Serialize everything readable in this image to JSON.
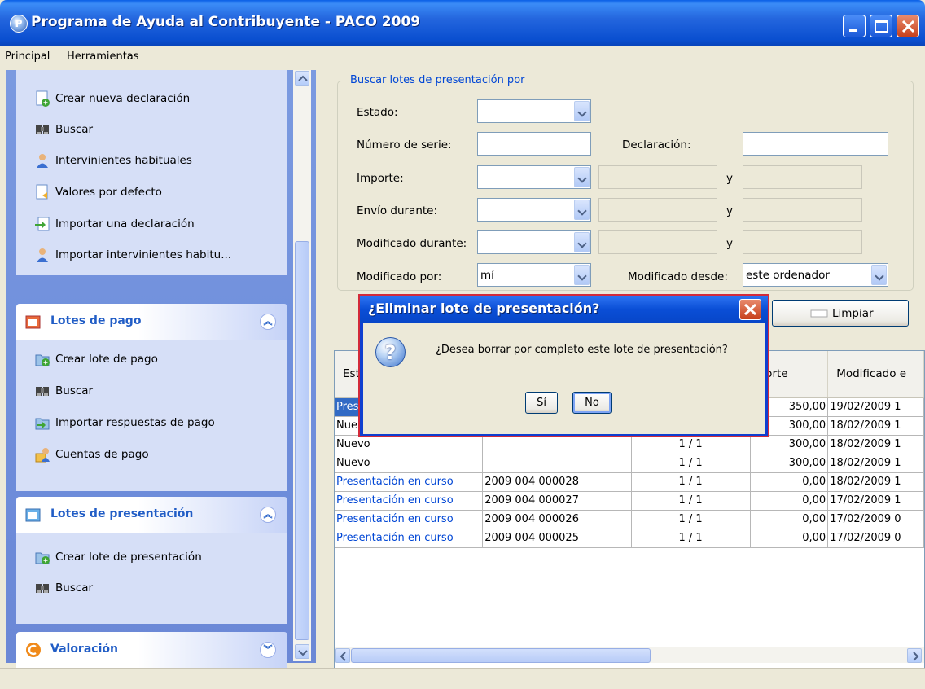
{
  "window": {
    "title": "Programa de Ayuda al Contribuyente - PACO 2009",
    "icon_letter": "P"
  },
  "menu": {
    "items": [
      "Principal",
      "Herramientas"
    ]
  },
  "sidebar": {
    "top_items": [
      {
        "label": "Crear nueva declaración",
        "icon": "new-document-icon"
      },
      {
        "label": "Buscar",
        "icon": "binoculars-icon"
      },
      {
        "label": "Intervinientes habituales",
        "icon": "person-icon"
      },
      {
        "label": "Valores por defecto",
        "icon": "document-icon"
      },
      {
        "label": "Importar una declaración",
        "icon": "import-icon"
      },
      {
        "label": "Importar intervinientes habitu...",
        "icon": "person-icon"
      }
    ],
    "lotes_pago": {
      "title": "Lotes de pago",
      "items": [
        {
          "label": "Crear lote de pago",
          "icon": "new-folder-icon"
        },
        {
          "label": "Buscar",
          "icon": "binoculars-icon"
        },
        {
          "label": "Importar respuestas de pago",
          "icon": "import-folder-icon"
        },
        {
          "label": "Cuentas de pago",
          "icon": "accounts-icon"
        }
      ]
    },
    "lotes_presentacion": {
      "title": "Lotes de presentación",
      "items": [
        {
          "label": "Crear lote de presentación",
          "icon": "new-folder-icon"
        },
        {
          "label": "Buscar",
          "icon": "binoculars-icon"
        }
      ]
    },
    "valoracion": {
      "title": "Valoración"
    }
  },
  "search": {
    "legend": "Buscar lotes de presentación por",
    "estado_label": "Estado:",
    "numero_serie_label": "Número de serie:",
    "declaracion_label": "Declaración:",
    "importe_label": "Importe:",
    "envio_label": "Envío durante:",
    "modificado_durante_label": "Modificado durante:",
    "modificado_por_label": "Modificado por:",
    "modificado_por_value": "mí",
    "modificado_desde_label": "Modificado desde:",
    "modificado_desde_value": "este ordenador",
    "y_label": "y",
    "limpiar_label": "Limpiar"
  },
  "table": {
    "headers": [
      "Est",
      "",
      "",
      "porte",
      "Modificado e"
    ],
    "rows": [
      {
        "estado": "Pres",
        "serie": "",
        "docs": "",
        "importe": "350,00",
        "modificado": "19/02/2009 1"
      },
      {
        "estado": "Nue",
        "serie": "",
        "docs": "",
        "importe": "300,00",
        "modificado": "18/02/2009 1"
      },
      {
        "estado": "Nuevo",
        "serie": "",
        "docs": "1 / 1",
        "importe": "300,00",
        "modificado": "18/02/2009 1"
      },
      {
        "estado": "Nuevo",
        "serie": "",
        "docs": "1 / 1",
        "importe": "300,00",
        "modificado": "18/02/2009 1"
      },
      {
        "estado": "Presentación en curso",
        "serie": "2009 004 000028",
        "docs": "1 / 1",
        "importe": "0,00",
        "modificado": "18/02/2009 1"
      },
      {
        "estado": "Presentación en curso",
        "serie": "2009 004 000027",
        "docs": "1 / 1",
        "importe": "0,00",
        "modificado": "17/02/2009 1"
      },
      {
        "estado": "Presentación en curso",
        "serie": "2009 004 000026",
        "docs": "1 / 1",
        "importe": "0,00",
        "modificado": "17/02/2009 0"
      },
      {
        "estado": "Presentación en curso",
        "serie": "2009 004 000025",
        "docs": "1 / 1",
        "importe": "0,00",
        "modificado": "17/02/2009 0"
      }
    ]
  },
  "dialog": {
    "title": "¿Eliminar lote de presentación?",
    "message": "¿Desea borrar por completo este lote de presentación?",
    "yes_label": "Sí",
    "no_label": "No"
  },
  "colors": {
    "title_blue": "#0a4fd0",
    "link_blue": "#0046d5",
    "dialog_border": "#d32a3a"
  }
}
